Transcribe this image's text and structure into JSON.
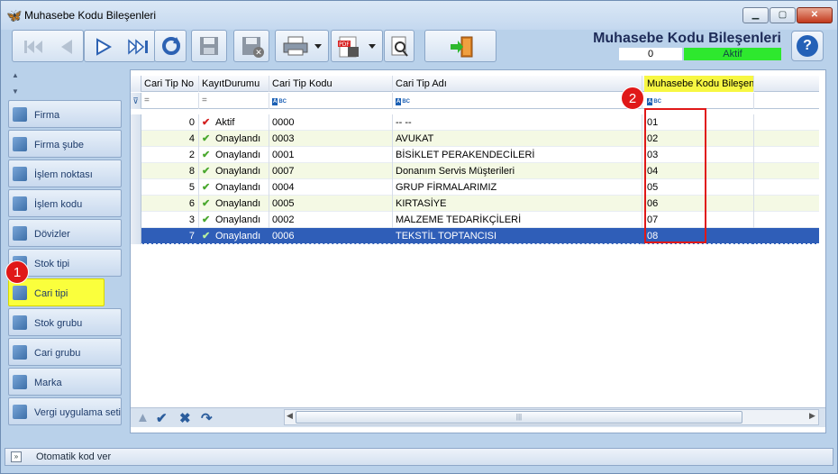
{
  "window": {
    "title": "Muhasebe Kodu Bileşenleri",
    "minimize_icon": "minimize-icon",
    "maximize_icon": "maximize-icon",
    "close_icon": "close-icon"
  },
  "toolbar": {
    "buttons": [
      "first-record-icon",
      "previous-record-icon",
      "next-record-icon",
      "last-record-icon",
      "refresh-icon",
      "save-icon",
      "delete-save-icon",
      "print-icon",
      "pdf-export-icon",
      "document-search-icon",
      "exit-door-icon"
    ]
  },
  "header": {
    "title": "Muhasebe Kodu Bileşenleri",
    "record_number": "0",
    "status": "Aktif",
    "status_color": "#2ee82e",
    "help_label": "?"
  },
  "sidebar": {
    "items": [
      {
        "label": "Firma",
        "icon": "company-icon"
      },
      {
        "label": "Firma şube",
        "icon": "branch-icon"
      },
      {
        "label": "İşlem noktası",
        "icon": "transaction-point-icon"
      },
      {
        "label": "İşlem kodu",
        "icon": "transaction-code-icon"
      },
      {
        "label": "Dövizler",
        "icon": "currency-icon"
      },
      {
        "label": "Stok tipi",
        "icon": "stock-type-icon"
      },
      {
        "label": "Cari tipi",
        "icon": "account-type-icon",
        "selected": true
      },
      {
        "label": "Stok grubu",
        "icon": "stock-group-icon"
      },
      {
        "label": "Cari grubu",
        "icon": "account-group-icon"
      },
      {
        "label": "Marka",
        "icon": "brand-icon"
      },
      {
        "label": "Vergi uygulama seti",
        "icon": "tax-set-icon"
      }
    ]
  },
  "grid": {
    "columns": [
      "Cari Tip No",
      "KayıtDurumu",
      "Cari Tip Kodu",
      "Cari Tip Adı",
      "Muhasebe Kodu Bileşeni"
    ],
    "filter_ops": [
      "=",
      "=",
      "ABC",
      "ABC",
      "ABC"
    ],
    "rows": [
      {
        "no": "0",
        "status": "Aktif",
        "kod": "0000",
        "ad": "-- --",
        "muhasebe": "01"
      },
      {
        "no": "4",
        "status": "Onaylandı",
        "kod": "0003",
        "ad": "AVUKAT",
        "muhasebe": "02"
      },
      {
        "no": "2",
        "status": "Onaylandı",
        "kod": "0001",
        "ad": "BİSİKLET PERAKENDECİLERİ",
        "muhasebe": "03"
      },
      {
        "no": "8",
        "status": "Onaylandı",
        "kod": "0007",
        "ad": "Donanım Servis Müşterileri",
        "muhasebe": "04"
      },
      {
        "no": "5",
        "status": "Onaylandı",
        "kod": "0004",
        "ad": "GRUP FİRMALARIMIZ",
        "muhasebe": "05"
      },
      {
        "no": "6",
        "status": "Onaylandı",
        "kod": "0005",
        "ad": "KIRTASİYE",
        "muhasebe": "06"
      },
      {
        "no": "3",
        "status": "Onaylandı",
        "kod": "0002",
        "ad": "MALZEME TEDARİKÇİLERİ",
        "muhasebe": "07"
      },
      {
        "no": "7",
        "status": "Onaylandı",
        "kod": "0006",
        "ad": "TEKSTİL TOPTANCISI",
        "muhasebe": "08",
        "selected": true
      }
    ]
  },
  "annotations": {
    "badge1": "1",
    "badge2": "2",
    "highlight_color": "#faff3c",
    "marker_color": "#e01818"
  },
  "bottom": {
    "label": "Otomatik kod ver"
  }
}
